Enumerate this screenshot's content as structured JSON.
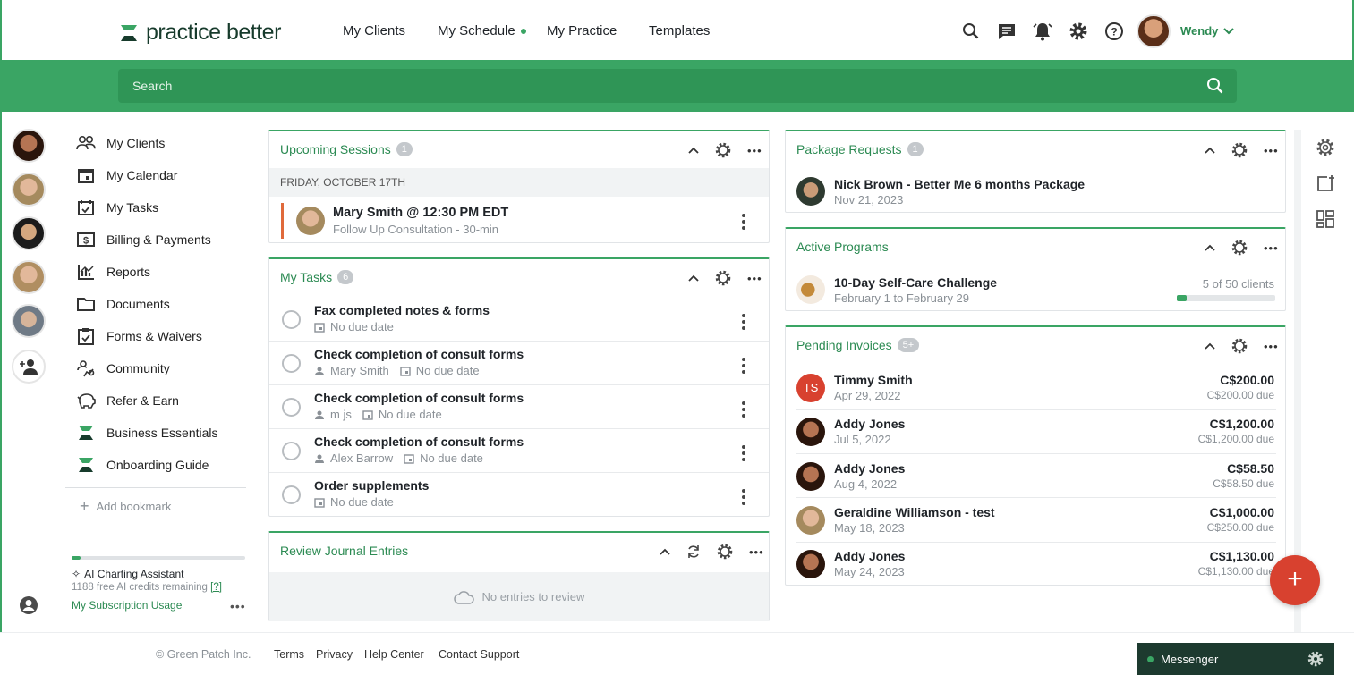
{
  "brand": {
    "name": "practice better",
    "color": "#3aa564"
  },
  "nav": {
    "clients": "My Clients",
    "schedule": "My Schedule",
    "practice": "My Practice",
    "templates": "Templates"
  },
  "user": {
    "name": "Wendy"
  },
  "search": {
    "placeholder": "Search"
  },
  "sidebar": {
    "items": [
      {
        "label": "My Clients",
        "icon": "people-icon"
      },
      {
        "label": "My Calendar",
        "icon": "calendar-icon"
      },
      {
        "label": "My Tasks",
        "icon": "tasks-icon"
      },
      {
        "label": "Billing & Payments",
        "icon": "dollar-icon"
      },
      {
        "label": "Reports",
        "icon": "chart-icon"
      },
      {
        "label": "Documents",
        "icon": "folder-icon"
      },
      {
        "label": "Forms & Waivers",
        "icon": "clipboard-icon"
      },
      {
        "label": "Community",
        "icon": "community-icon"
      },
      {
        "label": "Refer & Earn",
        "icon": "piggy-icon"
      },
      {
        "label": "Business Essentials",
        "icon": "hourglass-icon"
      },
      {
        "label": "Onboarding Guide",
        "icon": "hourglass-icon"
      }
    ],
    "add_bookmark": "Add bookmark",
    "ai": {
      "title": "AI Charting Assistant",
      "credits": "1188 free AI credits remaining",
      "help": "[?]",
      "usage": "My Subscription Usage"
    }
  },
  "upcoming": {
    "title": "Upcoming Sessions",
    "count": "1",
    "date": "FRIDAY, OCTOBER 17TH",
    "session": {
      "title": "Mary Smith @ 12:30 PM EDT",
      "sub": "Follow Up Consultation - 30-min"
    }
  },
  "tasks": {
    "title": "My Tasks",
    "count": "6",
    "items": [
      {
        "title": "Fax completed notes & forms",
        "person": "",
        "due": "No due date"
      },
      {
        "title": "Check completion of consult forms",
        "person": "Mary Smith",
        "due": "No due date"
      },
      {
        "title": "Check completion of consult forms",
        "person": "m js",
        "due": "No due date"
      },
      {
        "title": "Check completion of consult forms",
        "person": "Alex Barrow",
        "due": "No due date"
      },
      {
        "title": "Order supplements",
        "person": "",
        "due": "No due date"
      }
    ]
  },
  "journal": {
    "title": "Review Journal Entries",
    "empty": "No entries to review"
  },
  "packages": {
    "title": "Package Requests",
    "count": "1",
    "item": {
      "title": "Nick Brown - Better Me 6 months Package",
      "date": "Nov 21, 2023"
    }
  },
  "programs": {
    "title": "Active Programs",
    "item": {
      "title": "10-Day Self-Care Challenge",
      "dates": "February 1 to February 29",
      "clients": "5 of 50 clients",
      "progress": 0.1
    }
  },
  "invoices": {
    "title": "Pending Invoices",
    "count": "5+",
    "items": [
      {
        "initials": "TS",
        "name": "Timmy Smith",
        "date": "Apr 29, 2022",
        "amount": "C$200.00",
        "due": "C$200.00 due"
      },
      {
        "initials": "",
        "name": "Addy Jones",
        "date": "Jul 5, 2022",
        "amount": "C$1,200.00",
        "due": "C$1,200.00 due"
      },
      {
        "initials": "",
        "name": "Addy Jones",
        "date": "Aug 4, 2022",
        "amount": "C$58.50",
        "due": "C$58.50 due"
      },
      {
        "initials": "",
        "name": "Geraldine Williamson - test",
        "date": "May 18, 2023",
        "amount": "C$1,000.00",
        "due": "C$250.00 due"
      },
      {
        "initials": "",
        "name": "Addy Jones",
        "date": "May 24, 2023",
        "amount": "C$1,130.00",
        "due": "C$1,130.00 due"
      }
    ]
  },
  "footer": {
    "copy": "© Green Patch Inc.",
    "terms": "Terms",
    "privacy": "Privacy",
    "help": "Help Center",
    "support": "Contact Support"
  },
  "messenger": {
    "label": "Messenger"
  },
  "colors": {
    "accent": "#3aa564",
    "danger": "#d8412f",
    "dark": "#1d3a2f"
  }
}
